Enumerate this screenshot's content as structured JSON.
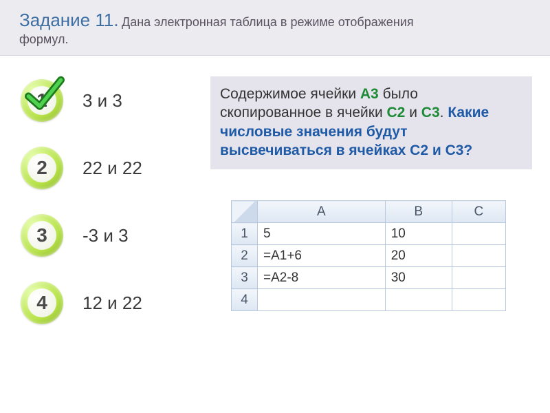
{
  "header": {
    "title_prefix": "Задание 11.",
    "title_rest": " Дана электронная таблица в режиме отображения",
    "subline": "формул."
  },
  "options": [
    {
      "num": "1",
      "text": "3 и 3",
      "correct": true
    },
    {
      "num": "2",
      "text": "22 и 22",
      "correct": false
    },
    {
      "num": "3",
      "text": "-3 и 3",
      "correct": false
    },
    {
      "num": "4",
      "text": "12 и 22",
      "correct": false
    }
  ],
  "question": {
    "part1": "Содержимое ячейки ",
    "a3": "А3",
    "part2": " было скопированное в ячейки ",
    "c2": "С2",
    "and1": " и ",
    "c3": "С3",
    "dot": ". ",
    "blue": "Какие числовые значения будут высвечиваться в ячейках С2 и С3?"
  },
  "sheet": {
    "cols": [
      "A",
      "B",
      "C"
    ],
    "rows": [
      {
        "n": "1",
        "cells": [
          "5",
          "10",
          ""
        ]
      },
      {
        "n": "2",
        "cells": [
          "=A1+6",
          "20",
          ""
        ]
      },
      {
        "n": "3",
        "cells": [
          "=A2-8",
          "30",
          ""
        ]
      },
      {
        "n": "4",
        "cells": [
          "",
          "",
          ""
        ]
      }
    ]
  }
}
